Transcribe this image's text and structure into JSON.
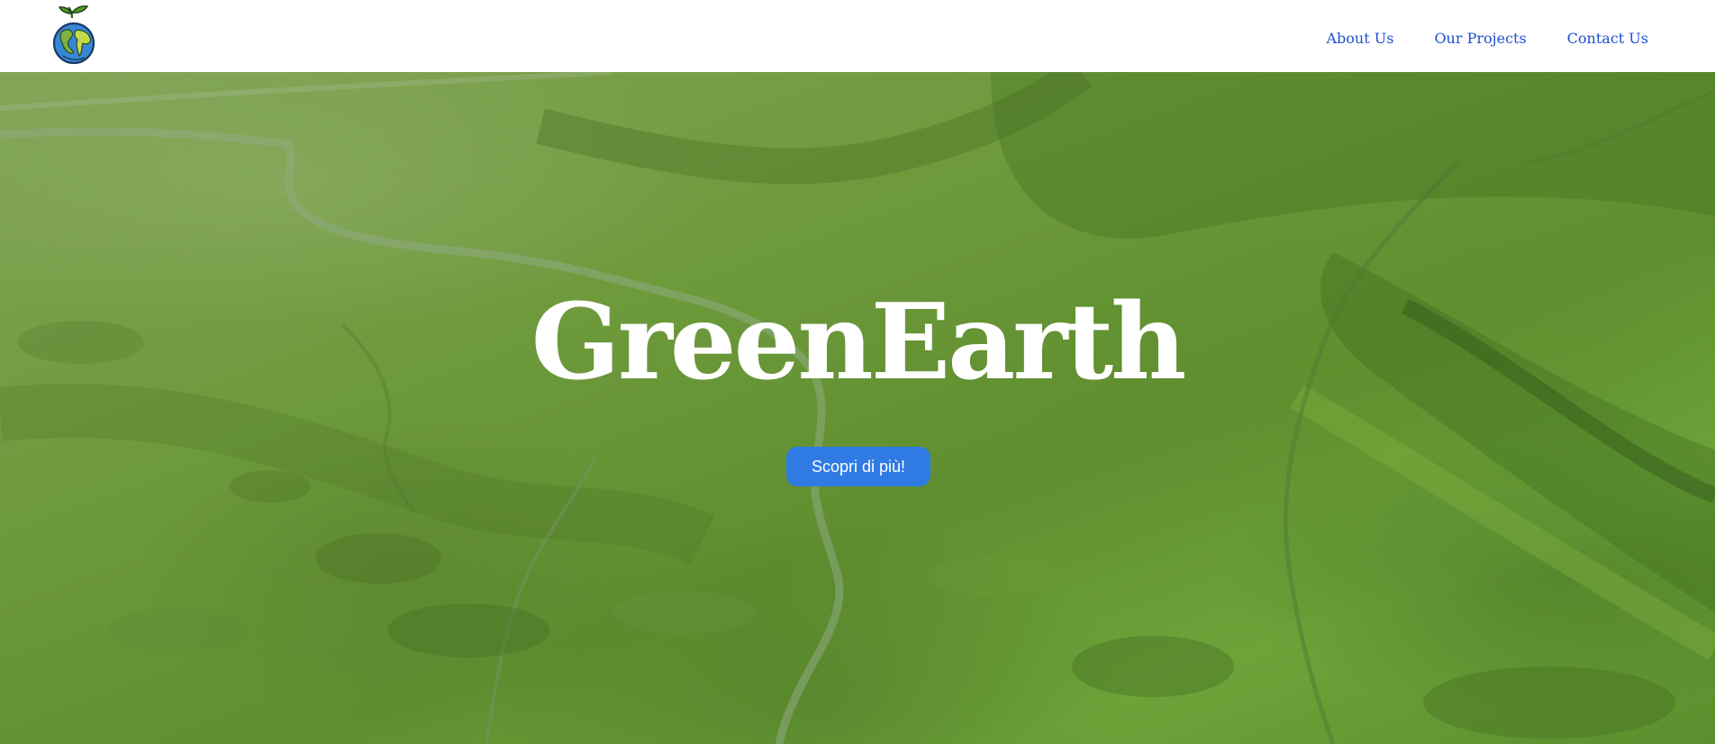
{
  "header": {
    "logo_icon": "earth-sprout-logo-icon",
    "nav": [
      {
        "label": "About Us"
      },
      {
        "label": "Our Projects"
      },
      {
        "label": "Contact Us"
      }
    ],
    "nav_color": "#1f4fd1"
  },
  "hero": {
    "title": "GreenEarth",
    "cta_label": "Scopri di più!",
    "cta_color": "#2f7be3",
    "background": "aerial-green-valley-image"
  }
}
